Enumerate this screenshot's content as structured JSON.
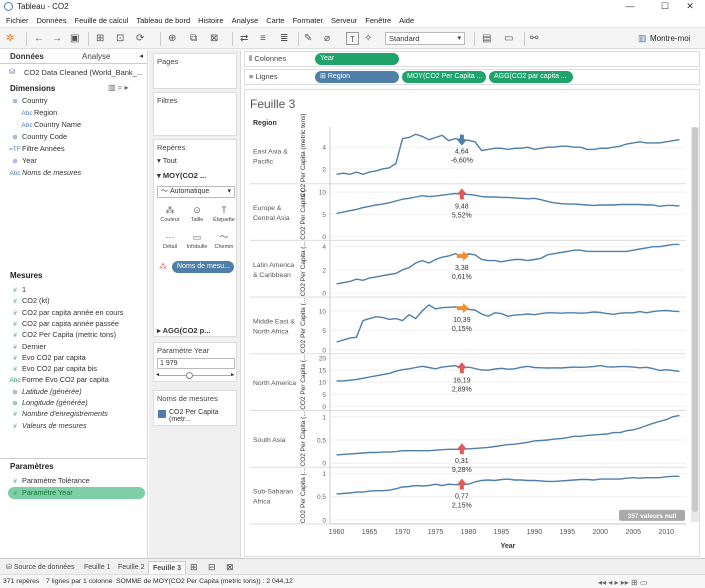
{
  "window": {
    "title": "Tableau - CO2",
    "min": "—",
    "max": "☐",
    "close": "✕"
  },
  "menu": [
    "Fichier",
    "Données",
    "Feuille de calcul",
    "Tableau de bord",
    "Histoire",
    "Analyse",
    "Carte",
    "Formater",
    "Serveur",
    "Fenêtre",
    "Aide"
  ],
  "toolbar": {
    "mark_type": "Standard",
    "show_me": "Montre-moi"
  },
  "left": {
    "tab_data": "Données",
    "tab_analysis": "Analyse",
    "source": "CO2 Data Cleaned (World_Bank_...",
    "dimensions_title": "Dimensions",
    "dimensions": [
      {
        "glyph": "⊕",
        "label": "Country",
        "indent": 0,
        "style": ""
      },
      {
        "glyph": "Abc",
        "label": "Region",
        "indent": 1,
        "style": ""
      },
      {
        "glyph": "Abc",
        "label": "Country Name",
        "indent": 1,
        "style": ""
      },
      {
        "glyph": "⊕",
        "label": "Country Code",
        "indent": 0,
        "style": ""
      },
      {
        "glyph": "=TF",
        "label": "Filtre Années",
        "indent": 0,
        "style": ""
      },
      {
        "glyph": "⊛",
        "label": "Year",
        "indent": 0,
        "style": ""
      },
      {
        "glyph": "Abc",
        "label": "Noms de mesures",
        "indent": 0,
        "style": "it"
      }
    ],
    "measures_title": "Mesures",
    "measures": [
      {
        "glyph": "#",
        "label": "1",
        "style": ""
      },
      {
        "glyph": "#",
        "label": "CO2 (kt)",
        "style": ""
      },
      {
        "glyph": "#",
        "label": "CO2 par capita année en cours",
        "style": ""
      },
      {
        "glyph": "#",
        "label": "CO2 par capita année passée",
        "style": ""
      },
      {
        "glyph": "#",
        "label": "CO2 Per Capita (metric tons)",
        "style": ""
      },
      {
        "glyph": "#",
        "label": "Dernier",
        "style": ""
      },
      {
        "glyph": "#",
        "label": "Evo CO2 par capita",
        "style": ""
      },
      {
        "glyph": "#",
        "label": "Evo CO2 par capita bis",
        "style": ""
      },
      {
        "glyph": "Abc",
        "label": "Forme Evo CO2 par capita",
        "style": ""
      },
      {
        "glyph": "⊕",
        "label": "Latitude (générée)",
        "style": "it"
      },
      {
        "glyph": "⊕",
        "label": "Longitude (générée)",
        "style": "it"
      },
      {
        "glyph": "#",
        "label": "Nombre d'enregistrements",
        "style": "it"
      },
      {
        "glyph": "#",
        "label": "Valeurs de mesures",
        "style": "it"
      }
    ],
    "params_title": "Paramètres",
    "params": [
      {
        "glyph": "#",
        "label": "Paramètre Tolérance"
      },
      {
        "glyph": "#",
        "label": "Paramètre Year"
      }
    ]
  },
  "mid": {
    "pages": "Pages",
    "filters": "Filtres",
    "marks": "Repères",
    "all": "Tout",
    "mark1": "MOY(CO2 ...",
    "auto": "Automatique",
    "buttons": [
      "Couleur",
      "Taille",
      "Étiquette",
      "Détail",
      "Infobulle",
      "Chemin"
    ],
    "names_pill": "Noms de mesu...",
    "mark2": "AGG(CO2 p...",
    "param_title": "Paramètre Year",
    "param_value": "1 979",
    "legend_title": "Noms de mesures",
    "legend_item": "CO2 Per Capita (metr..."
  },
  "shelves": {
    "columns_label": "Colonnes",
    "columns_pill": "Year",
    "rows_label": "Lignes",
    "rows_pills": [
      "Region",
      "MOY(CO2 Per Capita ...",
      "AGG(CO2 par capita ..."
    ]
  },
  "viz": {
    "sheet_title": "Feuille 3",
    "region_header": "Region",
    "axis_label": "CO2 Per Capita (metric tons)",
    "axis_label_short": "CO2 Per Capita (...",
    "x_title": "Year",
    "null_badge": "357 valeurs null"
  },
  "tabs": [
    "Source de données",
    "Feuille 1",
    "Feuille 2",
    "Feuille 3"
  ],
  "status": {
    "a": "371 repères",
    "b": "7 lignes par 1 colonne",
    "c": "SOMME de MOY(CO2 Per Capita (metric tons)) : 2 044,12"
  },
  "colors": {
    "line": "#4f7ea8",
    "up": "#e05a5a",
    "flat": "#f28e2b",
    "down": "#4f7ea8",
    "green": "#1fa36b"
  },
  "chart_data": {
    "type": "line",
    "x_ticks": [
      1960,
      1965,
      1970,
      1975,
      1980,
      1985,
      1990,
      1995,
      2000,
      2005,
      2010
    ],
    "xlim": [
      1959,
      2013
    ],
    "marker_year": 1979,
    "panels": [
      {
        "region": "East Asia & Pacific",
        "ticks": [
          2,
          4
        ],
        "ylim": [
          1,
          5.5
        ],
        "value": "4,64",
        "change": "-6,60%",
        "arrow": "down",
        "values": [
          1.5,
          1.6,
          1.5,
          1.7,
          1.5,
          1.7,
          1.8,
          2.0,
          2.1,
          2.5,
          4.8,
          4.9,
          5.2,
          5.0,
          4.7,
          4.9,
          5.1,
          4.6,
          4.8,
          4.7,
          4.64,
          4.5,
          3.7,
          3.8,
          3.9,
          3.9,
          3.8,
          3.9,
          3.9,
          4.0,
          3.8,
          3.9,
          4.0,
          4.0,
          4.1,
          4.1,
          4.0,
          4.0,
          3.8,
          3.8,
          3.9,
          3.9,
          4.0,
          4.1,
          4.3,
          4.4,
          4.5,
          4.4,
          4.4,
          4.4,
          4.5,
          4.6,
          4.7
        ]
      },
      {
        "region": "Europe & Central Asia",
        "ticks": [
          0,
          5,
          10
        ],
        "ylim": [
          0,
          11
        ],
        "value": "9,48",
        "change": "5,52%",
        "arrow": "up",
        "values": [
          5.2,
          5.5,
          5.8,
          6.1,
          6.5,
          6.8,
          7.1,
          7.3,
          7.6,
          8.0,
          8.4,
          8.6,
          8.9,
          9.2,
          9.0,
          9.1,
          9.3,
          9.5,
          9.7,
          9.5,
          9.48,
          9.3,
          9.0,
          8.9,
          8.9,
          8.8,
          8.8,
          8.7,
          8.6,
          8.5,
          8.6,
          8.3,
          7.9,
          7.6,
          7.4,
          7.3,
          7.3,
          7.2,
          7.1,
          7.0,
          7.1,
          7.1,
          7.1,
          7.2,
          7.2,
          7.2,
          7.2,
          7.1,
          7.1,
          6.8,
          7.0,
          7.0,
          6.9
        ]
      },
      {
        "region": "Latin America & Caribbean",
        "ticks": [
          0,
          2,
          4
        ],
        "ylim": [
          0,
          4.2
        ],
        "value": "3,38",
        "change": "0,61%",
        "arrow": "flat",
        "values": [
          0.8,
          0.9,
          1.0,
          1.2,
          1.1,
          1.3,
          1.4,
          1.5,
          1.6,
          1.7,
          2.0,
          2.2,
          2.6,
          2.8,
          2.6,
          2.9,
          3.1,
          3.2,
          3.4,
          3.2,
          3.38,
          3.3,
          2.9,
          2.8,
          2.8,
          2.7,
          2.8,
          2.9,
          2.9,
          2.8,
          2.9,
          3.0,
          3.3,
          3.4,
          3.5,
          3.6,
          3.7,
          3.7,
          3.6,
          3.6,
          3.6,
          3.6,
          3.6,
          3.6,
          3.6,
          3.7,
          3.8,
          3.9,
          4.0,
          4.0,
          4.1,
          4.2,
          4.2
        ]
      },
      {
        "region": "Middle East & North Africa",
        "ticks": [
          0,
          5,
          10
        ],
        "ylim": [
          0,
          12.5
        ],
        "value": "10,39",
        "change": "0,15%",
        "arrow": "flat",
        "values": [
          2.0,
          2.5,
          3.0,
          3.2,
          7.5,
          8.0,
          8.5,
          8.3,
          7.8,
          8.0,
          7.5,
          9.0,
          8.0,
          10.0,
          11.5,
          10.5,
          10.8,
          10.9,
          11.0,
          10.7,
          10.39,
          10.2,
          9.2,
          8.6,
          9.5,
          9.3,
          8.6,
          8.9,
          9.0,
          9.2,
          9.0,
          9.3,
          9.5,
          9.5,
          9.4,
          9.5,
          9.5,
          9.4,
          9.5,
          9.7,
          9.6,
          9.3,
          9.1,
          9.4,
          9.5,
          9.5,
          9.8,
          9.5,
          9.8,
          10.0,
          10.1,
          9.9,
          9.8
        ]
      },
      {
        "region": "North America",
        "ticks": [
          0,
          5,
          10,
          15,
          20
        ],
        "ylim": [
          0,
          20
        ],
        "value": "16,19",
        "change": "2,89%",
        "arrow": "up",
        "values": [
          10.5,
          10.5,
          10.8,
          11.1,
          11.6,
          12.1,
          12.6,
          13.1,
          13.6,
          14.5,
          15.1,
          15.5,
          16.0,
          16.5,
          16.0,
          15.5,
          16.2,
          16.5,
          16.8,
          15.7,
          16.19,
          15.6,
          15.0,
          14.9,
          15.4,
          15.7,
          15.3,
          15.5,
          16.1,
          16.5,
          16.0,
          15.9,
          15.8,
          15.9,
          15.8,
          16.0,
          16.2,
          16.1,
          16.2,
          16.4,
          16.8,
          16.3,
          16.2,
          16.4,
          16.4,
          16.2,
          15.9,
          16.1,
          15.6,
          14.8,
          15.1,
          14.8,
          14.4
        ]
      },
      {
        "region": "South Asia",
        "ticks": [
          0,
          0.5,
          1.0
        ],
        "ylim": [
          0,
          1.05
        ],
        "value": "0,31",
        "change": "9,28%",
        "arrow": "up",
        "values": [
          0.18,
          0.19,
          0.2,
          0.21,
          0.22,
          0.23,
          0.23,
          0.24,
          0.24,
          0.25,
          0.27,
          0.27,
          0.27,
          0.27,
          0.27,
          0.28,
          0.29,
          0.3,
          0.3,
          0.3,
          0.31,
          0.32,
          0.33,
          0.34,
          0.36,
          0.38,
          0.4,
          0.41,
          0.43,
          0.45,
          0.48,
          0.49,
          0.5,
          0.52,
          0.53,
          0.55,
          0.58,
          0.58,
          0.6,
          0.61,
          0.62,
          0.63,
          0.66,
          0.66,
          0.7,
          0.72,
          0.76,
          0.81,
          0.86,
          0.9,
          0.94,
          1.0,
          1.03
        ]
      },
      {
        "region": "Sub-Saharan Africa",
        "ticks": [
          0,
          0.5,
          1.0
        ],
        "ylim": [
          0,
          1.05
        ],
        "value": "0,77",
        "change": "2,15%",
        "arrow": "up",
        "values": [
          0.56,
          0.57,
          0.58,
          0.6,
          0.6,
          0.62,
          0.63,
          0.63,
          0.64,
          0.67,
          0.71,
          0.72,
          0.74,
          0.73,
          0.74,
          0.77,
          0.74,
          0.77,
          0.76,
          0.76,
          0.77,
          0.82,
          0.85,
          0.86,
          0.85,
          0.87,
          0.88,
          0.86,
          0.86,
          0.85,
          0.85,
          0.84,
          0.83,
          0.83,
          0.84,
          0.85,
          0.86,
          0.87,
          0.87,
          0.86,
          0.88,
          0.88,
          0.88,
          0.88,
          0.9,
          0.91,
          0.9,
          0.91,
          0.91,
          0.91,
          0.93,
          0.94,
          0.94
        ]
      }
    ]
  }
}
